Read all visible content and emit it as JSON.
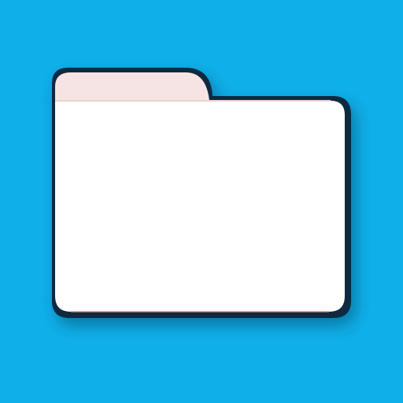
{
  "app": {
    "background_color": "#0FB0EA",
    "icon": {
      "name": "folder-icon",
      "colors": {
        "tab": "#F6E4E4",
        "body": "#FFFFFF",
        "outline": "#102A3F",
        "shadow": "#06324D"
      }
    }
  }
}
